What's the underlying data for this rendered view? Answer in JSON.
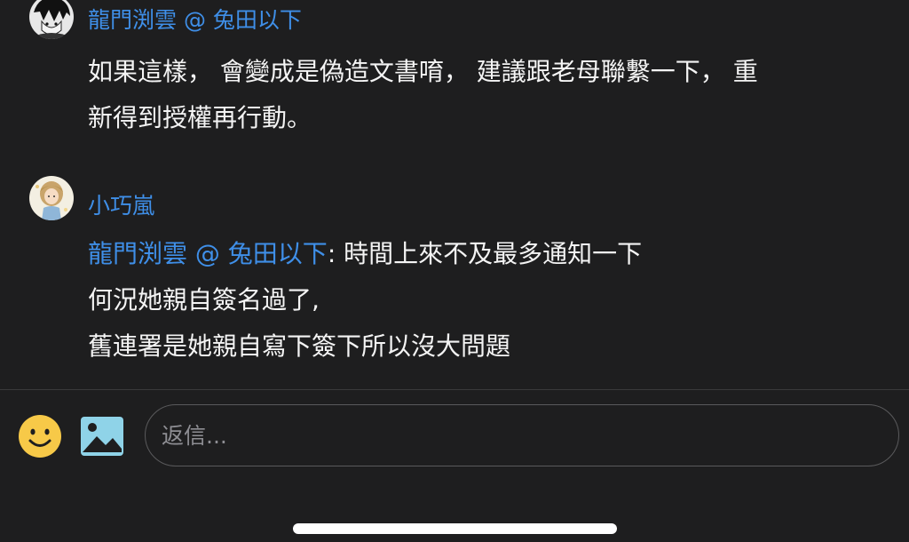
{
  "comments": [
    {
      "author": "龍門渕雲 @ 兔田以下",
      "avatar_icon": "manga-character-avatar",
      "lines": [
        "如果這樣， 會變成是偽造文書唷， 建議跟老母聯繫一下， 重",
        "新得到授權再行動。"
      ]
    },
    {
      "author": "小巧嵐",
      "avatar_icon": "illustrated-girl-avatar",
      "mention": "龍門渕雲 @ 兔田以下",
      "first_line_rest": ": 時間上來不及最多通知一下",
      "lines": [
        "何況她親自簽名過了,",
        "舊連署是她親自寫下簽下所以沒大問題"
      ]
    }
  ],
  "composer": {
    "emoji_icon": "smiley-face-icon",
    "image_icon": "image-upload-icon",
    "placeholder": "返信..."
  },
  "colors": {
    "background": "#1e1e1f",
    "accent": "#3f8fe8",
    "emoji": "#f7c948",
    "image_icon": "#8fd3e8"
  }
}
